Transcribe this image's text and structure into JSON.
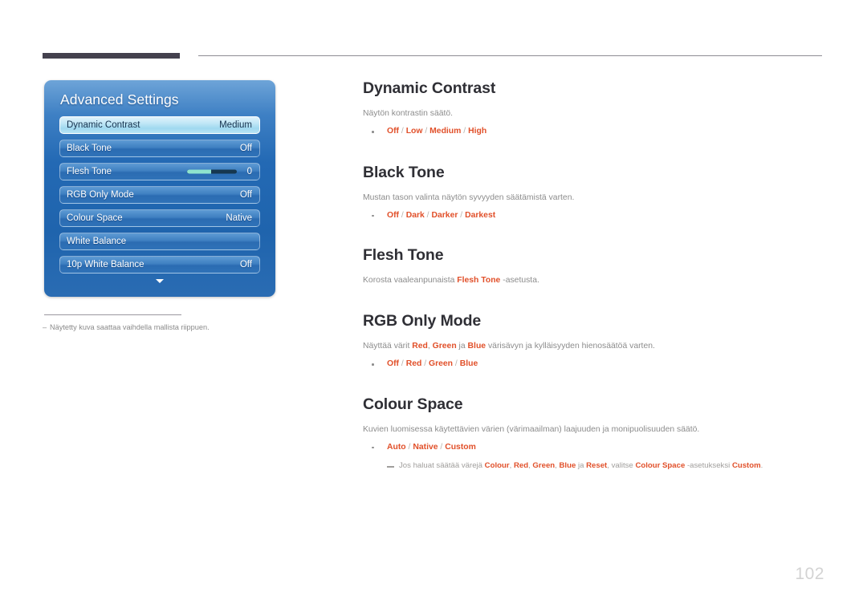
{
  "header": {
    "bar_color": "#44414e",
    "rule_color": "#8e8c93"
  },
  "osd": {
    "title": "Advanced Settings",
    "more_icon": "chevron-down-icon",
    "rows": [
      {
        "label": "Dynamic Contrast",
        "value": "Medium",
        "selected": true,
        "type": "value"
      },
      {
        "label": "Black Tone",
        "value": "Off",
        "selected": false,
        "type": "value"
      },
      {
        "label": "Flesh Tone",
        "value": "0",
        "selected": false,
        "type": "slider",
        "slider_fill_pct": 48
      },
      {
        "label": "RGB Only Mode",
        "value": "Off",
        "selected": false,
        "type": "value"
      },
      {
        "label": "Colour Space",
        "value": "Native",
        "selected": false,
        "type": "value"
      },
      {
        "label": "White Balance",
        "value": "",
        "selected": false,
        "type": "plain"
      },
      {
        "label": "10p White Balance",
        "value": "Off",
        "selected": false,
        "type": "value"
      }
    ]
  },
  "figure_note": {
    "dash": "–",
    "text": "Näytetty kuva saattaa vaihdella mallista riippuen."
  },
  "sections": {
    "dynamic_contrast": {
      "title": "Dynamic Contrast",
      "desc": "Näytön kontrastin säätö.",
      "options": [
        "Off",
        "Low",
        "Medium",
        "High"
      ]
    },
    "black_tone": {
      "title": "Black Tone",
      "desc": "Mustan tason valinta näytön syvyyden säätämistä varten.",
      "options": [
        "Off",
        "Dark",
        "Darker",
        "Darkest"
      ]
    },
    "flesh_tone": {
      "title": "Flesh Tone",
      "desc_pre": "Korosta vaaleanpunaista ",
      "desc_hl": "Flesh Tone",
      "desc_post": " -asetusta."
    },
    "rgb_only_mode": {
      "title": "RGB Only Mode",
      "desc_1": "Näyttää värit ",
      "hl_red": "Red",
      "desc_2": ", ",
      "hl_green": "Green",
      "desc_3": " ja ",
      "hl_blue": "Blue",
      "desc_4": " värisävyn ja kylläisyyden hienosäätöä varten.",
      "options": [
        "Off",
        "Red",
        "Green",
        "Blue"
      ]
    },
    "colour_space": {
      "title": "Colour Space",
      "desc": "Kuvien luomisessa käytettävien värien (värimaailman) laajuuden ja monipuolisuuden säätö.",
      "options": [
        "Auto",
        "Native",
        "Custom"
      ],
      "subnote": {
        "p1": "Jos haluat säätää värejä ",
        "h1": "Colour",
        "p2": ", ",
        "h2": "Red",
        "p3": ", ",
        "h3": "Green",
        "p4": ", ",
        "h4": "Blue",
        "p5": " ja ",
        "h5": "Reset",
        "p6": ", valitse ",
        "h6": "Colour Space",
        "p7": " -asetukseksi ",
        "h7": "Custom",
        "p8": "."
      }
    }
  },
  "footer": {
    "page_number": "102"
  },
  "colors": {
    "accent": "#e1502a",
    "body_text": "#8c8c8c",
    "heading": "#2f2f35",
    "osd_blue": "#2369b4",
    "osd_selected": "#bfe6f6",
    "page_number": "#d3d3d3"
  }
}
